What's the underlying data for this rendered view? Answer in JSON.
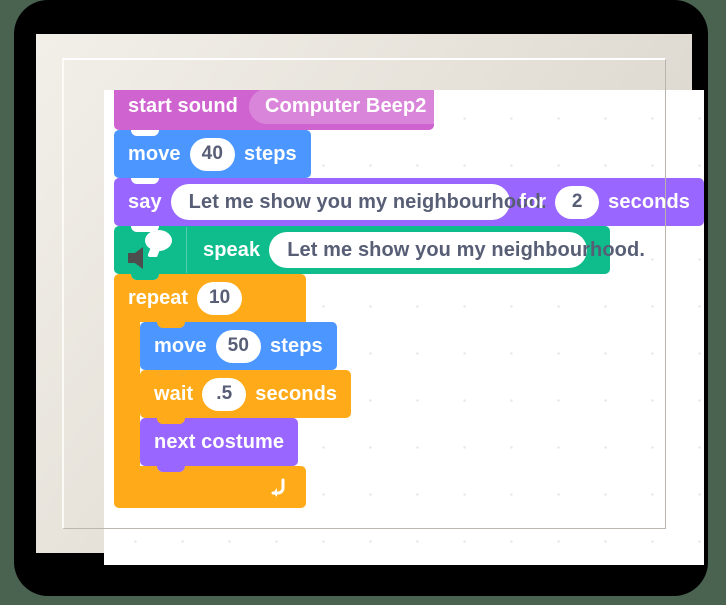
{
  "app": {
    "name": "Scratch",
    "view": "code-workspace",
    "frame_style": "white-picture-frame"
  },
  "colors": {
    "sound": "#CF63CF",
    "motion": "#4C97FF",
    "looks": "#9966FF",
    "text_to_speech": "#0FBD8C",
    "control": "#FFAB19",
    "input_text": "#575E75",
    "canvas": "#FFFFFF",
    "frame": "#E8E4DC",
    "backdrop": "#000000",
    "background": "#4A6350"
  },
  "script": {
    "blocks": [
      {
        "id": "start-sound",
        "category": "sound",
        "label": "start sound",
        "dropdown_value": "Computer Beep2",
        "dropdown_icon": "chevron-down-icon"
      },
      {
        "id": "move-40",
        "category": "motion",
        "label_before": "move",
        "value": "40",
        "label_after": "steps"
      },
      {
        "id": "say-for-seconds",
        "category": "looks",
        "label_before": "say",
        "message": "Let me show you my neighbourhood.",
        "label_middle": "for",
        "seconds": "2",
        "label_after": "seconds"
      },
      {
        "id": "speak",
        "category": "text_to_speech",
        "icon": "text-to-speech-icon",
        "label_before": "speak",
        "message": "Let me show you my neighbourhood."
      },
      {
        "id": "repeat-loop",
        "category": "control",
        "label": "repeat",
        "times": "10",
        "loop_icon": "loop-arrow-icon",
        "children": [
          {
            "id": "move-50",
            "category": "motion",
            "label_before": "move",
            "value": "50",
            "label_after": "steps"
          },
          {
            "id": "wait-seconds",
            "category": "control",
            "label_before": "wait",
            "value": ".5",
            "label_after": "seconds"
          },
          {
            "id": "next-costume",
            "category": "looks",
            "label": "next costume"
          }
        ]
      }
    ]
  }
}
